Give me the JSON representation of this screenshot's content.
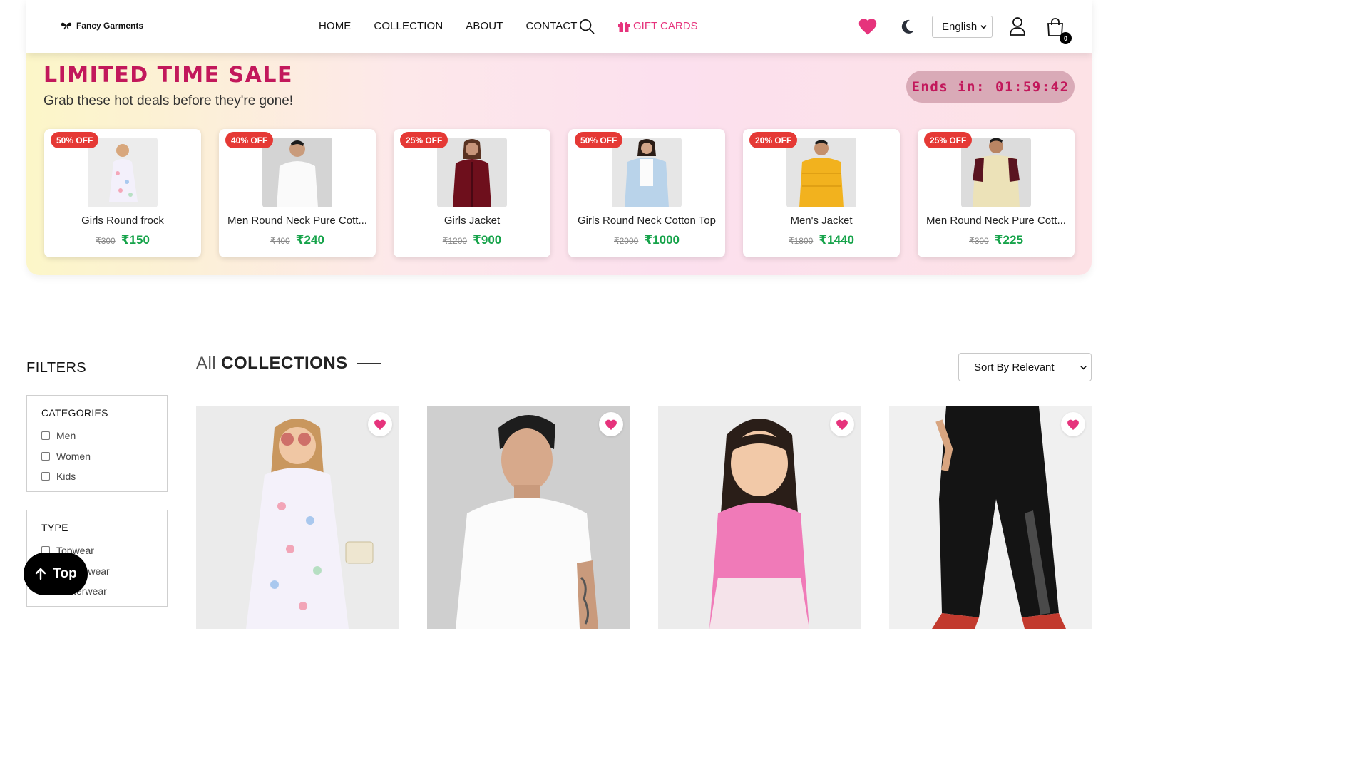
{
  "brand": {
    "name": "Fancy Garments"
  },
  "nav": {
    "items": [
      "HOME",
      "COLLECTION",
      "ABOUT",
      "CONTACT"
    ],
    "gift_label": "GIFT CARDS",
    "language": "English",
    "cart_count": "0"
  },
  "sale": {
    "title": "LIMITED TIME SALE",
    "subtitle": "Grab these hot deals before they're gone!",
    "timer_label": "Ends in:",
    "timer_value": "01:59:42",
    "deals": [
      {
        "badge": "50% OFF",
        "name": "Girls Round frock",
        "old_price": "₹300",
        "new_price": "₹150"
      },
      {
        "badge": "40% OFF",
        "name": "Men Round Neck Pure Cott...",
        "old_price": "₹400",
        "new_price": "₹240"
      },
      {
        "badge": "25% OFF",
        "name": "Girls Jacket",
        "old_price": "₹1200",
        "new_price": "₹900"
      },
      {
        "badge": "50% OFF",
        "name": "Girls Round Neck Cotton Top",
        "old_price": "₹2000",
        "new_price": "₹1000"
      },
      {
        "badge": "20% OFF",
        "name": "Men's Jacket",
        "old_price": "₹1800",
        "new_price": "₹1440"
      },
      {
        "badge": "25% OFF",
        "name": "Men Round Neck Pure Cott...",
        "old_price": "₹300",
        "new_price": "₹225"
      }
    ]
  },
  "filters": {
    "title": "FILTERS",
    "categories": {
      "heading": "CATEGORIES",
      "options": [
        "Men",
        "Women",
        "Kids"
      ]
    },
    "type": {
      "heading": "TYPE",
      "options": [
        "Topwear",
        "Bottomwear",
        "Winterwear"
      ]
    }
  },
  "collection": {
    "title_light": "All",
    "title_bold": "COLLECTIONS",
    "sort_label": "Sort By Relevant"
  },
  "top_button": {
    "label": "Top"
  },
  "colors": {
    "accent": "#e6337c",
    "sale_title": "#c2185b",
    "price": "#16a34a",
    "badge": "#e53935"
  }
}
